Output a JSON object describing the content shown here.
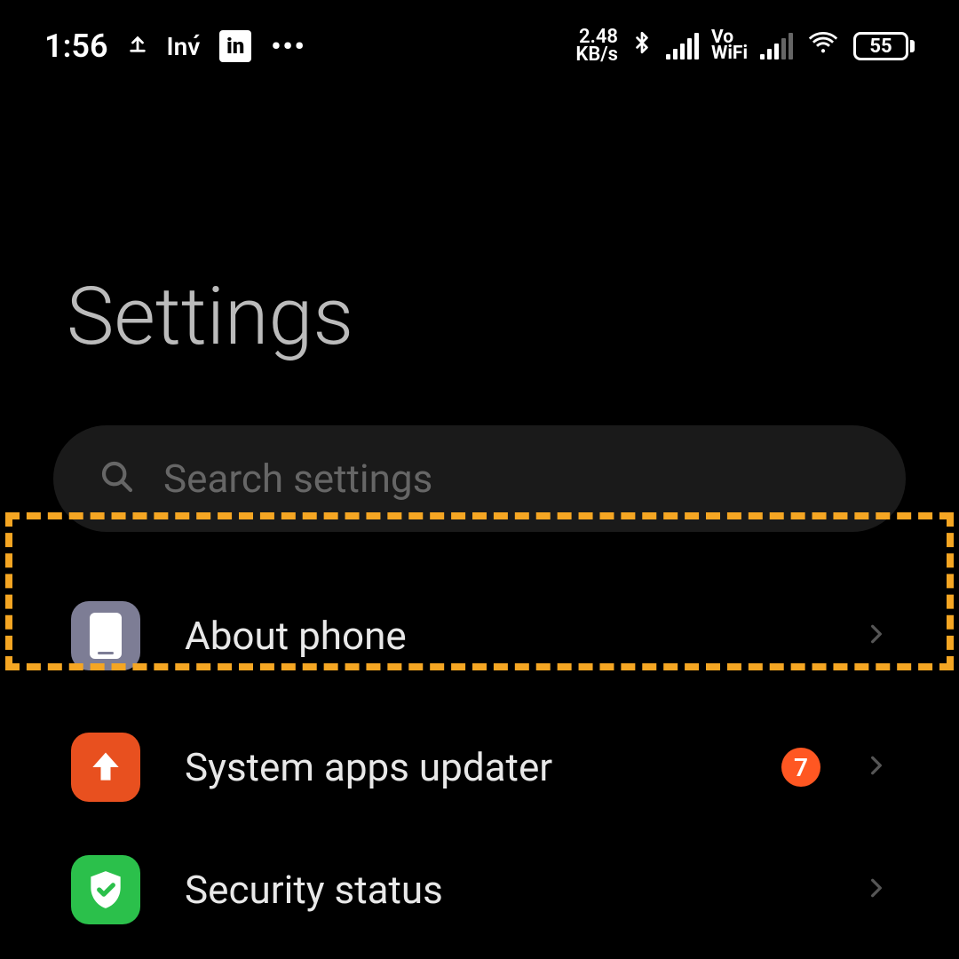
{
  "status_bar": {
    "time": "1:56",
    "inv_label": "Inv",
    "linkedin_label": "in",
    "more_dots": "•••",
    "data_speed_value": "2.48",
    "data_speed_unit": "KB/s",
    "vowifi_top": "Vo",
    "vowifi_bottom": "WiFi",
    "battery_level": "55"
  },
  "header": {
    "title": "Settings"
  },
  "search": {
    "placeholder": "Search settings"
  },
  "items": [
    {
      "label": "About phone"
    },
    {
      "label": "System apps updater",
      "badge": "7"
    },
    {
      "label": "Security status"
    }
  ]
}
